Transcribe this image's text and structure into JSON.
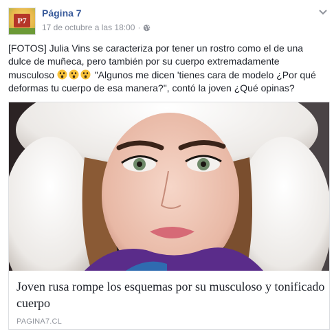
{
  "header": {
    "avatar_text": "P7",
    "page_name": "Página 7",
    "timestamp": "17 de octubre a las 18:00",
    "separator": "·",
    "privacy_icon": "globe-icon",
    "options_icon": "chevron-down-icon"
  },
  "message": {
    "text_before": "[FOTOS] Julia Vins se caracteriza por tener un rostro como el de una dulce de muñeca, pero también por su cuerpo extremadamente musculoso ",
    "emojis": [
      "astonished-face-emoji",
      "astonished-face-emoji",
      "astonished-face-emoji"
    ],
    "text_after": " \"Algunos me dicen 'tienes cara de modelo ¿Por qué deformas tu cuerpo de esa manera?\", contó la joven ¿Qué opinas?"
  },
  "link_card": {
    "title": "Joven rusa rompe los esquemas por su musculoso y tonificado cuerpo",
    "domain": "PAGINA7.CL"
  },
  "colors": {
    "link_blue": "#365899",
    "meta_gray": "#90949c",
    "text": "#1d2129",
    "border": "#dddfe2"
  }
}
